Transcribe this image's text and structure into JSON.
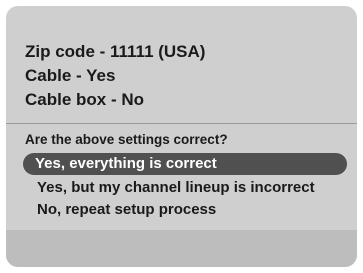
{
  "summary": {
    "zip": "Zip code - 11111 (USA)",
    "cable": "Cable - Yes",
    "cable_box": "Cable box - No"
  },
  "prompt": {
    "question": "Are the above settings correct?"
  },
  "options": [
    {
      "label": "Yes, everything is correct",
      "selected": true
    },
    {
      "label": "Yes, but my channel lineup is incorrect",
      "selected": false
    },
    {
      "label": "No, repeat setup process",
      "selected": false
    }
  ],
  "colors": {
    "background": "#cfcfcf",
    "highlight": "#505050",
    "footer": "#bdbdbd"
  }
}
